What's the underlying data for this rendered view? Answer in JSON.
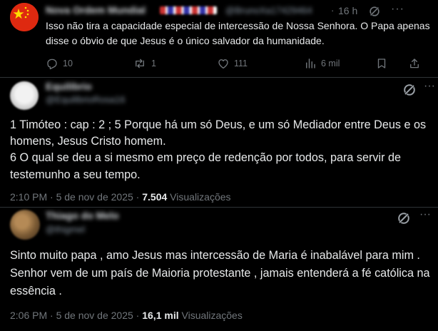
{
  "tweets": [
    {
      "display_name": "Nova Ordem Mundial",
      "handle": "@BrunoXa17429464",
      "separator": "·",
      "time": "16 h",
      "more": "···",
      "avatar_icon": "china-flag-icon",
      "text": "Isso não tira a capacidade especial de intercessão de Nossa Senhora. O Papa apenas disse o óbvio de que Jesus é o único salvador da humanidade.",
      "actions": {
        "replies": "10",
        "reposts": "1",
        "likes": "111",
        "views": "6 mil"
      }
    },
    {
      "display_name": "Equilibrio",
      "handle": "@EquilibrioRosa16",
      "more": "···",
      "avatar_icon": "white-avatar-icon",
      "text_lines": [
        "1 Timóteo : cap : 2 ; 5 Porque há um só Deus, e um só Mediador entre Deus e os homens, Jesus Cristo homem.",
        "6 O qual se deu a si mesmo em preço de redenção por todos, para servir de testemunho a seu tempo."
      ],
      "timestamp": "2:10 PM · 5 de nov de 2025 ·",
      "views_count": "7.504",
      "views_label": "Visualizações"
    },
    {
      "display_name": "Thiago do Melo",
      "handle": "@thigmel",
      "more": "···",
      "avatar_icon": "photo-avatar-icon",
      "text": "Sinto muito papa , amo Jesus mas intercessão de Maria é inabalável para mim . Senhor vem de um país de Maioria protestante , jamais entenderá a fé católica na essência .",
      "timestamp": "2:06 PM · 5 de nov de 2025 ·",
      "views_count": "16,1 mil",
      "views_label": "Visualizações"
    }
  ],
  "colors": {
    "background": "#000000",
    "text": "#e7e9ea",
    "muted": "#71767b",
    "divider": "#2f3336"
  }
}
